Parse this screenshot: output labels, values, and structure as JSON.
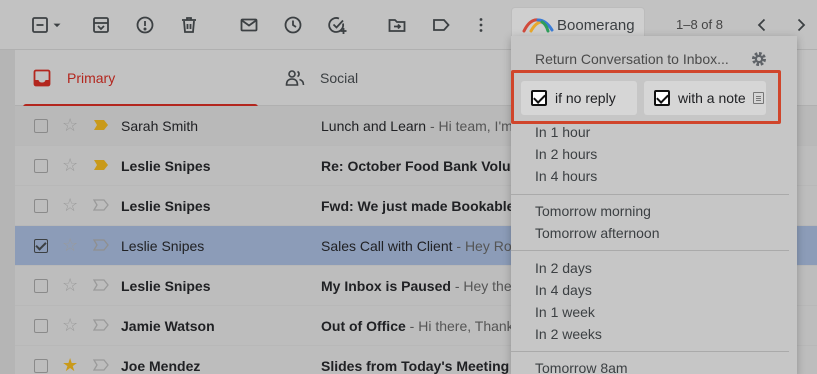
{
  "toolbar": {
    "icons": [
      "select-checkbox-icon",
      "select-dropdown-icon",
      "archive-icon",
      "report-spam-icon",
      "delete-icon",
      "mark-unread-icon",
      "snooze-icon",
      "add-task-icon",
      "move-to-icon",
      "label-icon",
      "more-icon"
    ],
    "count": "1–8 of 8",
    "boomerang_label": "Boomerang"
  },
  "tabs": [
    {
      "label": "Primary",
      "active": true
    },
    {
      "label": "Social",
      "active": false
    }
  ],
  "emails": [
    {
      "sender": "Sarah Smith",
      "subject": "Lunch and Learn",
      "snippet": " - Hi team, I'm",
      "unread": false,
      "selected": false,
      "starred": false,
      "important": true
    },
    {
      "sender": "Leslie Snipes",
      "subject": "Re: October Food Bank Volunt",
      "snippet": "",
      "unread": true,
      "selected": false,
      "starred": false,
      "important": true
    },
    {
      "sender": "Leslie Snipes",
      "subject": "Fwd: We just made Bookable",
      "snippet": "",
      "unread": true,
      "selected": false,
      "starred": false,
      "important": false
    },
    {
      "sender": "Leslie Snipes",
      "subject": "Sales Call with Client",
      "snippet": " - Hey Ro",
      "unread": false,
      "selected": true,
      "starred": false,
      "important": false
    },
    {
      "sender": "Leslie Snipes",
      "subject": "My Inbox is Paused",
      "snippet": " - Hey ther",
      "unread": true,
      "selected": false,
      "starred": false,
      "important": false
    },
    {
      "sender": "Jamie Watson",
      "subject": "Out of Office",
      "snippet": " - Hi there, Thank",
      "unread": true,
      "selected": false,
      "starred": false,
      "important": false
    },
    {
      "sender": "Joe Mendez",
      "subject": "Slides from Today's Meeting",
      "snippet": " -",
      "unread": true,
      "selected": false,
      "starred": true,
      "important": false
    }
  ],
  "boomerang_menu": {
    "title": "Return Conversation to Inbox...",
    "options": [
      {
        "label": "if no reply",
        "checked": true
      },
      {
        "label": "with a note",
        "checked": true
      }
    ],
    "group1": [
      "In 1 hour",
      "In 2 hours",
      "In 4 hours"
    ],
    "group2": [
      "Tomorrow morning",
      "Tomorrow afternoon"
    ],
    "group3": [
      "In 2 days",
      "In 4 days",
      "In 1 week",
      "In 2 weeks"
    ],
    "group4": [
      "Tomorrow 8am"
    ]
  },
  "colors": {
    "highlight_border": "#d0452b",
    "primary_tab": "#b3261e",
    "selected_row": "#8c9cb8"
  }
}
